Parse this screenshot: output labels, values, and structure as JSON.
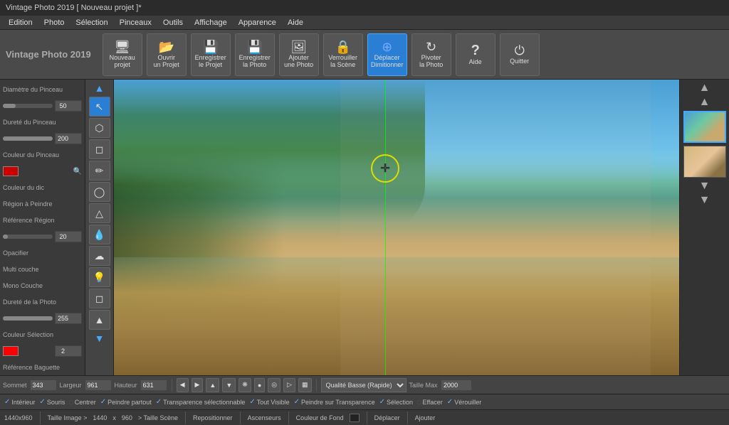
{
  "title_bar": {
    "text": "Vintage Photo 2019 [ Nouveau projet ]*"
  },
  "menu_bar": {
    "items": [
      "Edition",
      "Photo",
      "Sélection",
      "Pinceaux",
      "Outils",
      "Affichage",
      "Apparence",
      "Aide"
    ]
  },
  "toolbar": {
    "app_title_line1": "Vintage Photo 2019",
    "buttons": [
      {
        "id": "nouveau",
        "icon": "🖥",
        "label": "Nouveau\nprojet"
      },
      {
        "id": "ouvrir",
        "icon": "📂",
        "label": "Ouvrir\nun Projet"
      },
      {
        "id": "enregistrer_projet",
        "icon": "💾",
        "label": "Enregistrer\nle Projet"
      },
      {
        "id": "enregistrer_photo",
        "icon": "🔒",
        "label": "Enregistrer\nla Photo"
      },
      {
        "id": "ajouter_photo",
        "icon": "🖼",
        "label": "Ajouter\nune Photo"
      },
      {
        "id": "verrouiller",
        "icon": "🔒",
        "label": "Verrouiller\nla Scène"
      },
      {
        "id": "deplacer",
        "icon": "⊕",
        "label": "Déplacer\nDimitionner",
        "active": true
      },
      {
        "id": "pivoter",
        "icon": "↻",
        "label": "Pivoter\nla Photo"
      },
      {
        "id": "aide",
        "icon": "?",
        "label": "Aide"
      },
      {
        "id": "quitter",
        "icon": "⏻",
        "label": "Quitter"
      }
    ]
  },
  "left_panel": {
    "labels": {
      "diametre": "Diamètre du Pinceau",
      "durete": "Dureté du Pinceau",
      "couleur": "Couleur du Pinceau",
      "couleur_val": "#cc0000",
      "couleur_dic": "Couleur du dic",
      "region": "Région à Peindre",
      "reference_region": "Référence Région",
      "region_val": "20",
      "opacifier": "Opacifier",
      "multi_couche": "Multi couche",
      "mono_couche": "Mono Couche",
      "durete_photo": "Dureté de la Photo",
      "durete_val": "255",
      "couleur_selection": "Couleur Sélection",
      "couleur_sel_val": "2",
      "reference_baguette": "Référence Baguette"
    },
    "diametre_val": "50",
    "durete_val": "200"
  },
  "tool_palette": {
    "tools": [
      "↖",
      "⬡",
      "◻",
      "🖊",
      "◯",
      "△",
      "💧",
      "☁",
      "💡",
      "◻",
      "🔺",
      "🔵"
    ]
  },
  "canvas": {
    "crosshair_visible": true
  },
  "bottom_toolbar": {
    "nav_btns": [
      "◀",
      "▶",
      "▲",
      "▼",
      "❋",
      "●",
      "◎",
      "▷",
      "▦"
    ],
    "quality_label": "Qualité Basse (Rapide)",
    "taille_label": "Taille Max",
    "taille_val": "2000",
    "coordinates": {
      "x_label": "Sommet",
      "y_label": "Largeur",
      "h_label": "Hauteur",
      "x_val": "343",
      "y_val": "961",
      "h_val": "631"
    }
  },
  "checkboxes": [
    {
      "id": "interieur",
      "label": "Intérieur",
      "checked": true
    },
    {
      "id": "souris",
      "label": "Souris",
      "checked": true
    },
    {
      "id": "centrer",
      "label": "Centrer",
      "checked": false
    },
    {
      "id": "peindre_partout",
      "label": "Peindre partout",
      "checked": true
    },
    {
      "id": "transparence_selectionnable",
      "label": "Transparence sélectionnable",
      "checked": true
    },
    {
      "id": "tout_visible",
      "label": "Tout Visible",
      "checked": true
    },
    {
      "id": "peindre_transparence",
      "label": "Peindre sur Transparence",
      "checked": true
    },
    {
      "id": "selection",
      "label": "Sélection",
      "checked": true
    },
    {
      "id": "effacer",
      "label": "Effacer",
      "checked": false
    },
    {
      "id": "verrouiller",
      "label": "Vérouiller",
      "checked": true
    }
  ],
  "status_bar": {
    "resolution": "1440x960",
    "taille_image_label": "Taille Image >",
    "width": "1440",
    "height": "960",
    "taille_scene_label": "> Taille Scène",
    "repositionner_label": "Repositionner",
    "ascenseurs_label": "Ascenseurs",
    "couleur_fond_label": "Couleur de Fond",
    "deplacer_label": "Déplacer",
    "ajouter_label": "Ajouter"
  }
}
